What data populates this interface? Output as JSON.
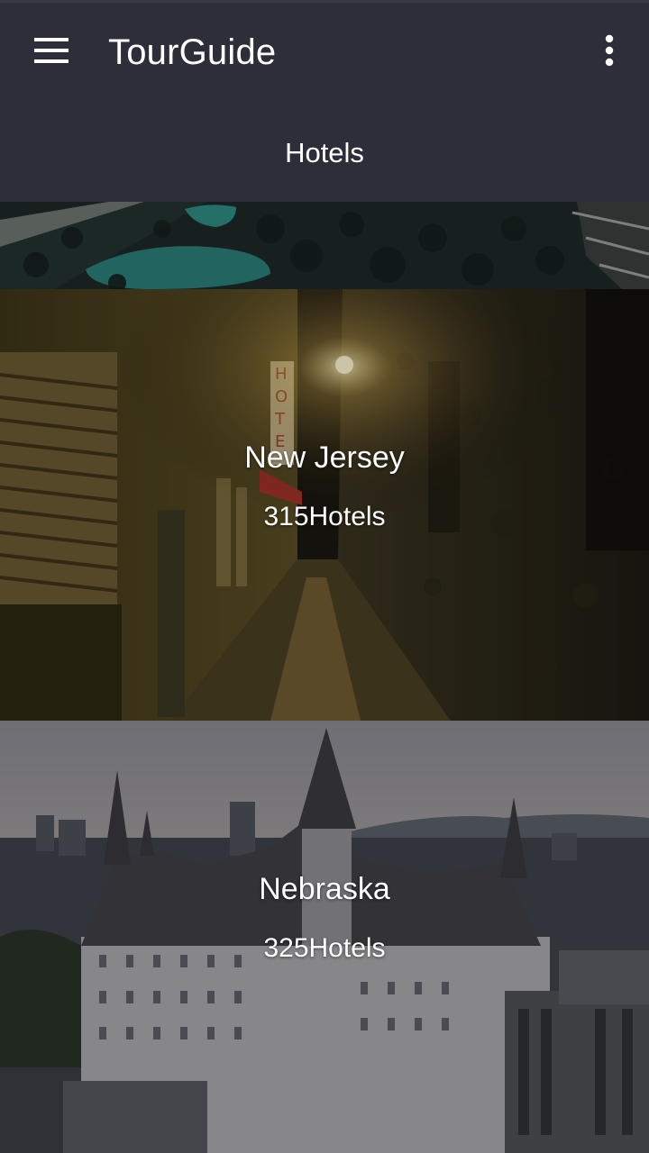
{
  "app": {
    "title": "TourGuide",
    "tab_label": "Hotels"
  },
  "icons": {
    "menu": "menu-icon",
    "overflow": "more-vert-icon"
  },
  "colors": {
    "appbar": "#2e2d3a",
    "text": "#ffffff"
  },
  "cards": [
    {
      "name": "",
      "count": "",
      "image": "resort-pool-aerial"
    },
    {
      "name": "New Jersey",
      "count": "315Hotels",
      "image": "hotel-alley-night"
    },
    {
      "name": "Nebraska",
      "count": "325Hotels",
      "image": "chateau-city-dusk"
    }
  ]
}
